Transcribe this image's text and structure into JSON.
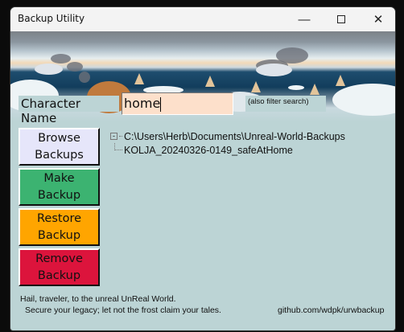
{
  "window": {
    "title": "Backup Utility",
    "controls": [
      "minimize",
      "maximize",
      "close"
    ]
  },
  "header": {
    "character_label": "Character Name",
    "character_value": "home",
    "filter_note": "(also filter search)"
  },
  "buttons": [
    {
      "line1": "Browse",
      "line2": "Backups",
      "color": "#e6e6fa"
    },
    {
      "line1": "Make",
      "line2": "Backup",
      "color": "#3cb371"
    },
    {
      "line1": "Restore",
      "line2": "Backup",
      "color": "#ffa500"
    },
    {
      "line1": "Remove",
      "line2": "Backup",
      "color": "#dc143c"
    }
  ],
  "tree": {
    "root": "C:\\Users\\Herb\\Documents\\Unreal-World-Backups",
    "children": [
      "KOLJA_20240326-0149_safeAtHome"
    ]
  },
  "footer": {
    "line1": "Hail, traveler, to the unreal UnReal World.",
    "line2": "Secure your legacy; let not the frost claim your tales.",
    "link": "github.com/wdpk/urwbackup"
  }
}
